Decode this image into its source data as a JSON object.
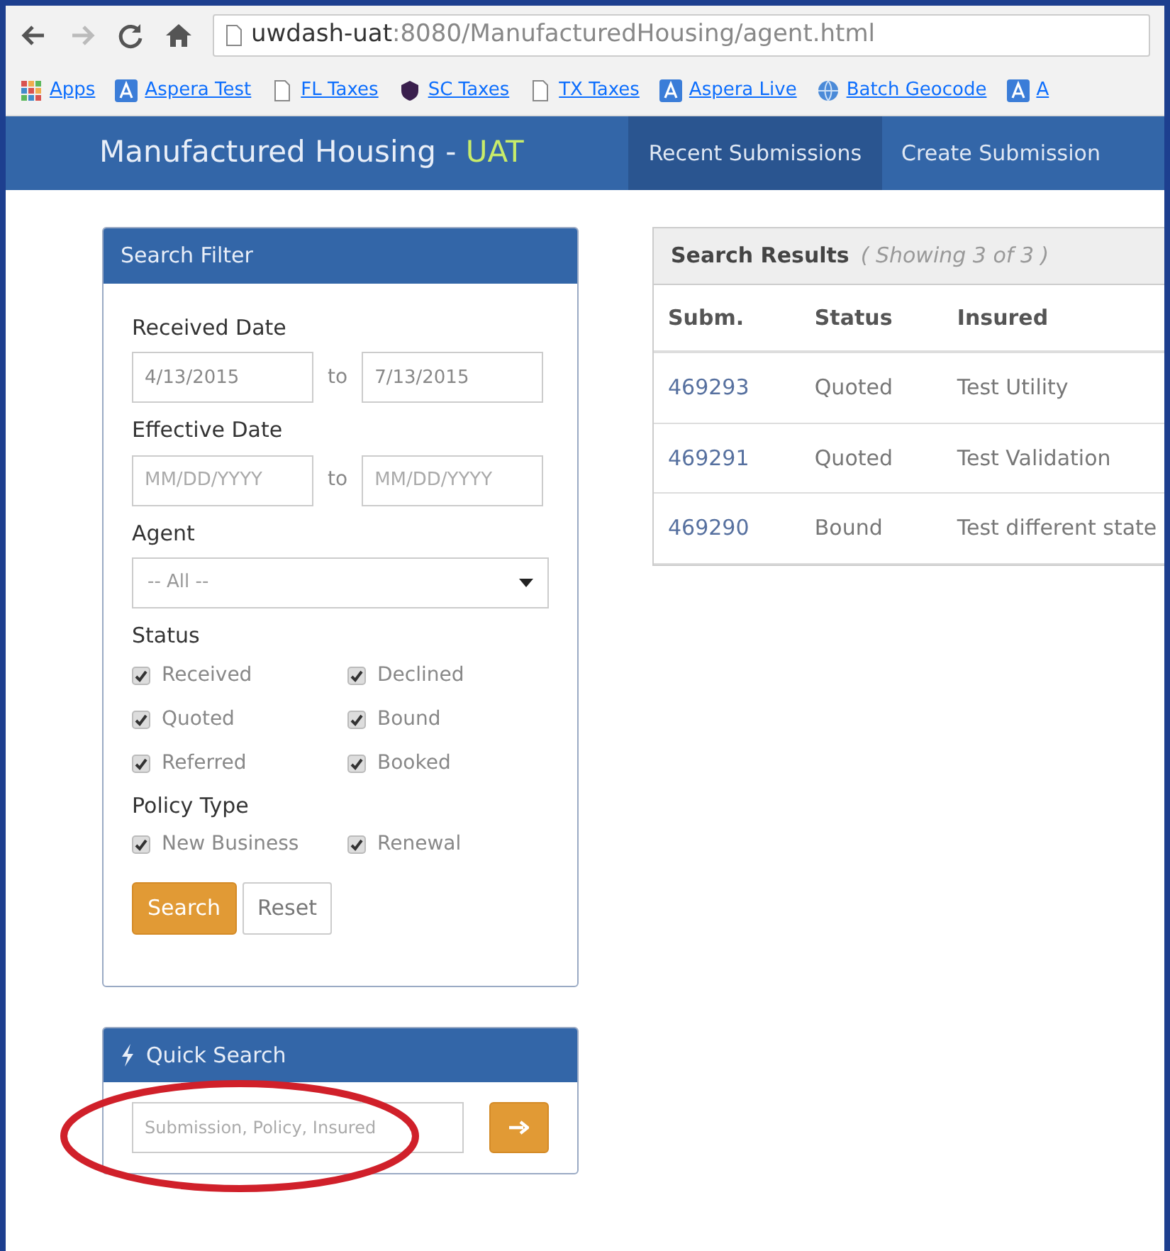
{
  "browser": {
    "url_host": "uwdash-uat",
    "url_rest": ":8080/ManufacturedHousing/agent.html",
    "bookmarks": [
      {
        "label": "Apps",
        "kind": "grid"
      },
      {
        "label": "Aspera Test",
        "kind": "app"
      },
      {
        "label": "FL Taxes",
        "kind": "page"
      },
      {
        "label": "SC Taxes",
        "kind": "shield"
      },
      {
        "label": "TX Taxes",
        "kind": "page"
      },
      {
        "label": "Aspera Live",
        "kind": "app"
      },
      {
        "label": "Batch Geocode",
        "kind": "globe"
      },
      {
        "label": "A",
        "kind": "app"
      }
    ]
  },
  "navbar": {
    "brand": "Manufactured Housing",
    "separator": "-",
    "env": "UAT",
    "items": [
      {
        "label": "Recent Submissions",
        "selected": true
      },
      {
        "label": "Create Submission",
        "selected": false
      }
    ]
  },
  "search_filter": {
    "title": "Search Filter",
    "received_date": {
      "label": "Received Date",
      "from": "4/13/2015",
      "joiner": "to",
      "to": "7/13/2015"
    },
    "effective_date": {
      "label": "Effective Date",
      "from_placeholder": "MM/DD/YYYY",
      "joiner": "to",
      "to_placeholder": "MM/DD/YYYY"
    },
    "agent": {
      "label": "Agent",
      "value": "-- All --"
    },
    "status": {
      "label": "Status",
      "options": [
        {
          "label": "Received",
          "checked": true
        },
        {
          "label": "Declined",
          "checked": true
        },
        {
          "label": "Quoted",
          "checked": true
        },
        {
          "label": "Bound",
          "checked": true
        },
        {
          "label": "Referred",
          "checked": true
        },
        {
          "label": "Booked",
          "checked": true
        }
      ]
    },
    "policy_type": {
      "label": "Policy Type",
      "options": [
        {
          "label": "New Business",
          "checked": true
        },
        {
          "label": "Renewal",
          "checked": true
        }
      ]
    },
    "buttons": [
      {
        "label": "Search",
        "kind": "primary"
      },
      {
        "label": "Reset",
        "kind": "secondary"
      }
    ]
  },
  "quick_search": {
    "title": "Quick Search",
    "placeholder": "Submission, Policy, Insured"
  },
  "search_results": {
    "title": "Search Results",
    "subtitle": "( Showing 3 of 3 )",
    "columns": [
      "Subm.",
      "Status",
      "Insured"
    ],
    "rows": [
      [
        "469293",
        "Quoted",
        "Test Utility"
      ],
      [
        "469291",
        "Quoted",
        "Test Validation"
      ],
      [
        "469290",
        "Bound",
        "Test different state"
      ]
    ]
  }
}
